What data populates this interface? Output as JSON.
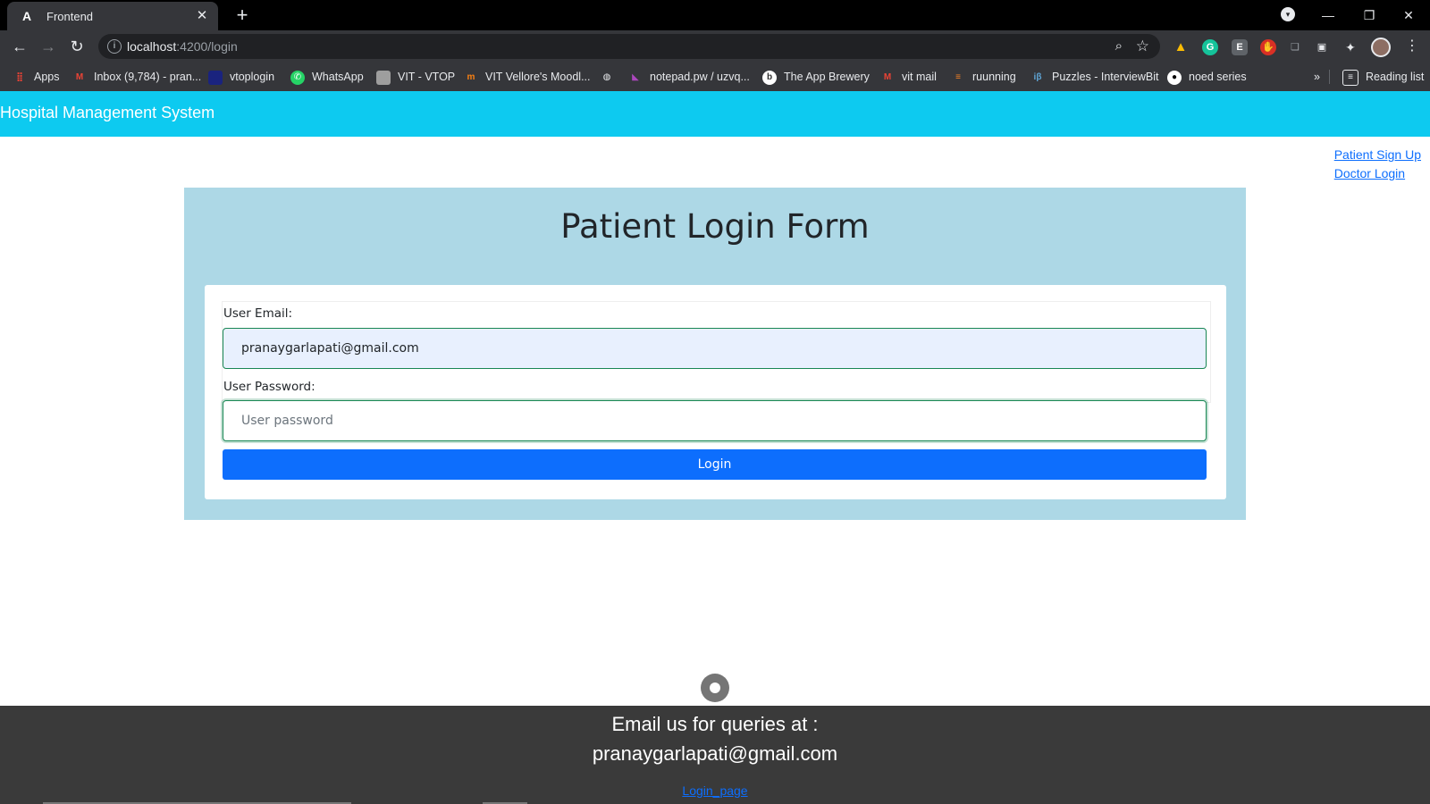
{
  "browser": {
    "tab_title": "Frontend",
    "url_host": "localhost",
    "url_path": ":4200/login",
    "bookmarks": [
      {
        "label": "Apps",
        "icon": "apps-grid-icon",
        "color": "#ea4335"
      },
      {
        "label": "Inbox (9,784) - pran...",
        "icon": "gmail-icon",
        "color": "#ea4335"
      },
      {
        "label": "vtoplogin",
        "icon": "vtop-icon",
        "color": "#1a237e"
      },
      {
        "label": "WhatsApp",
        "icon": "whatsapp-icon",
        "color": "#25d366"
      },
      {
        "label": "VIT - VTOP",
        "icon": "page-icon",
        "color": "#9e9e9e"
      },
      {
        "label": "VIT Vellore's Moodl...",
        "icon": "moodle-icon",
        "color": "#f98012"
      },
      {
        "label": "",
        "icon": "globe-icon",
        "color": "#e8eaed"
      },
      {
        "label": "notepad.pw / uzvq...",
        "icon": "notepad-icon",
        "color": "#ab47bc"
      },
      {
        "label": "The App Brewery",
        "icon": "app-brewery-icon",
        "color": "#ffffff"
      },
      {
        "label": "vit mail",
        "icon": "gmail-icon",
        "color": "#ea4335"
      },
      {
        "label": "ruunning",
        "icon": "stackoverflow-icon",
        "color": "#f48024"
      },
      {
        "label": "Puzzles - InterviewBit",
        "icon": "interviewbit-icon",
        "color": "#5fa6d6"
      },
      {
        "label": "noed series",
        "icon": "github-icon",
        "color": "#ffffff"
      }
    ],
    "overflow": "»",
    "reading_list": "Reading list"
  },
  "header": {
    "brand": "Hospital Management System"
  },
  "nav_links": {
    "signup": "Patient Sign Up",
    "doctor": "Doctor Login"
  },
  "form": {
    "heading": "Patient Login Form",
    "email_label": "User Email:",
    "email_value": "pranaygarlapati@gmail.com",
    "password_label": "User Password:",
    "password_placeholder": "User password",
    "login_button": "Login"
  },
  "footer": {
    "line1": "Email us for queries at :",
    "line2": "pranaygarlapati@gmail.com",
    "link": "Login_page"
  },
  "colors": {
    "header_bg": "#0dcaf0",
    "panel_bg": "#add8e6",
    "button_bg": "#0d6efd",
    "field_border": "#198754",
    "footer_bg": "#3a3a3a"
  }
}
